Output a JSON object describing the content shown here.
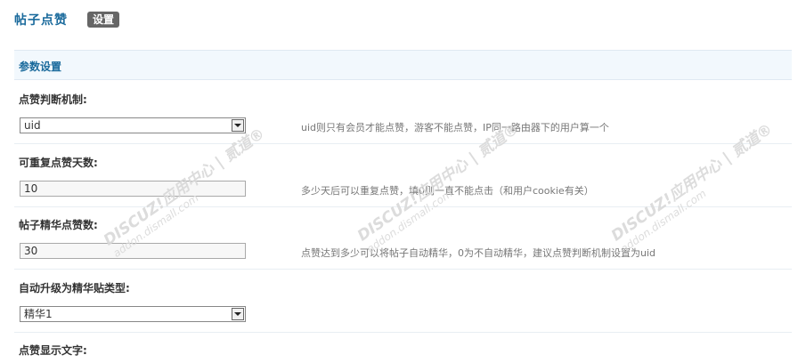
{
  "header": {
    "title": "帖子点赞",
    "tab": "设置"
  },
  "section": {
    "title": "参数设置"
  },
  "rows": [
    {
      "label": "点赞判断机制:",
      "value": "uid",
      "hint": "uid则只有会员才能点赞，游客不能点赞，IP同一路由器下的用户算一个"
    },
    {
      "label": "可重复点赞天数:",
      "value": "10",
      "hint": "多少天后可以重复点赞，填0则一直不能点击（和用户cookie有关）"
    },
    {
      "label": "帖子精华点赞数:",
      "value": "30",
      "hint": "点赞达到多少可以将帖子自动精华，0为不自动精华，建议点赞判断机制设置为uid"
    },
    {
      "label": "自动升级为精华贴类型:",
      "value": "精华1"
    },
    {
      "label": "点赞显示文字:"
    }
  ],
  "watermark": {
    "brand": "DISCUZ!应用中心 | 贰道®",
    "url": "addon.dismall.com"
  },
  "icons": {
    "dropdown": "chevron-down-icon"
  },
  "colors": {
    "accent": "#1a6a9c",
    "section_bg": "#f2f8fd",
    "tab_bg": "#666666"
  }
}
